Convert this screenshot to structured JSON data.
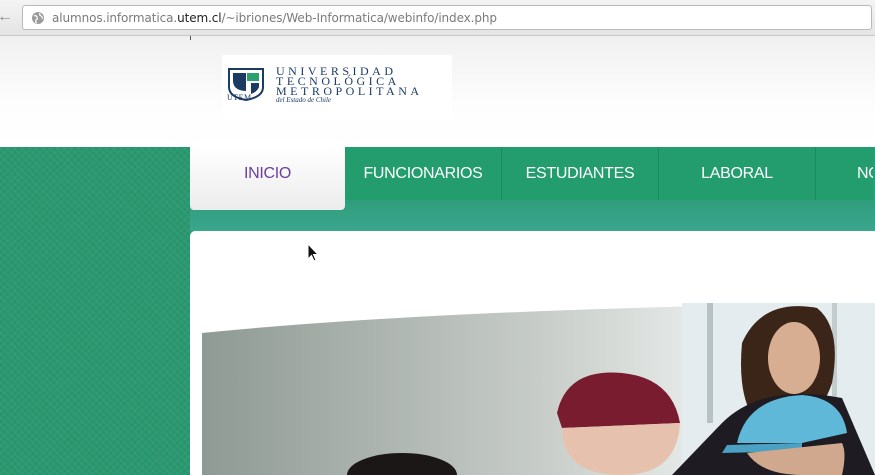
{
  "browser": {
    "url_prefix": "alumnos.informatica.",
    "url_domain": "utem.cl",
    "url_path": "/~ibriones/Web-Informatica/webinfo/index.php",
    "back_icon": "back-arrow-icon",
    "site_icon": "globe-icon"
  },
  "logo": {
    "line1": "UNIVERSIDAD",
    "line2": "TECNOLÓGICA",
    "line3": "METROPOLITANA",
    "subtitle": "del Estado de Chile",
    "abbr": "UTEM"
  },
  "nav": {
    "items": [
      {
        "label": "INICIO"
      },
      {
        "label": "FUNCIONARIOS"
      },
      {
        "label": "ESTUDIANTES"
      },
      {
        "label": "LABORAL"
      },
      {
        "label": "NO"
      }
    ]
  },
  "colors": {
    "brand_green": "#2a9870",
    "active_tab_text": "#6b3fa0",
    "logo_navy": "#1c3b63"
  }
}
